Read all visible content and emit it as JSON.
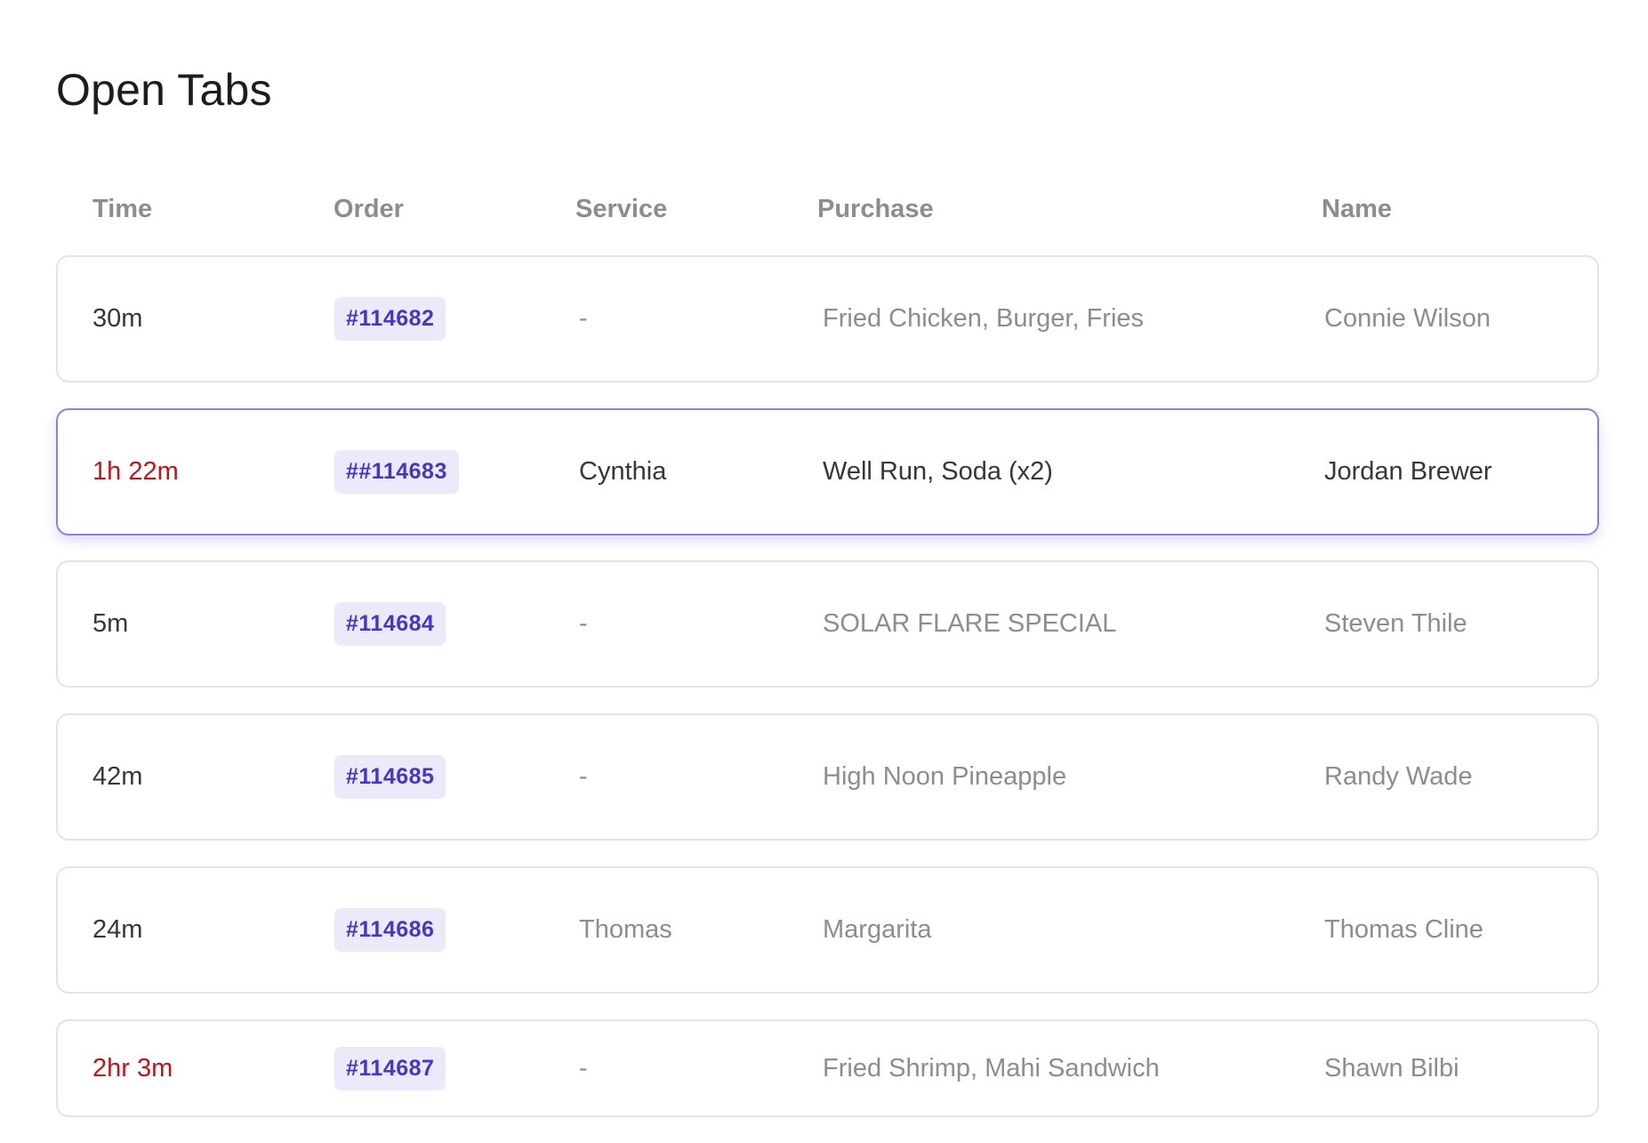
{
  "page": {
    "title": "Open Tabs"
  },
  "table": {
    "columns": {
      "time": "Time",
      "order": "Order",
      "service": "Service",
      "purchase": "Purchase",
      "name": "Name"
    },
    "rows": [
      {
        "time": "30m",
        "order": "#114682",
        "service": "-",
        "purchase": "Fried Chicken, Burger, Fries",
        "name": "Connie Wilson",
        "overdue": false,
        "selected": false
      },
      {
        "time": "1h 22m",
        "order": "##114683",
        "service": "Cynthia",
        "purchase": "Well Run, Soda (x2)",
        "name": "Jordan Brewer",
        "overdue": true,
        "selected": true
      },
      {
        "time": "5m",
        "order": "#114684",
        "service": "-",
        "purchase": "SOLAR FLARE SPECIAL",
        "name": "Steven Thile",
        "overdue": false,
        "selected": false
      },
      {
        "time": "42m",
        "order": "#114685",
        "service": "-",
        "purchase": "High Noon Pineapple",
        "name": "Randy Wade",
        "overdue": false,
        "selected": false
      },
      {
        "time": "24m",
        "order": "#114686",
        "service": "Thomas",
        "purchase": "Margarita",
        "name": "Thomas Cline",
        "overdue": false,
        "selected": false
      },
      {
        "time": "2hr 3m",
        "order": "#114687",
        "service": "-",
        "purchase": "Fried Shrimp, Mahi Sandwich",
        "name": "Shawn Bilbi",
        "overdue": true,
        "selected": false
      }
    ]
  },
  "colors": {
    "overdue": "#c0141a",
    "order_badge_bg": "#ece9fb",
    "order_badge_text": "#4336c9",
    "selected_border": "#8b7ff0"
  }
}
